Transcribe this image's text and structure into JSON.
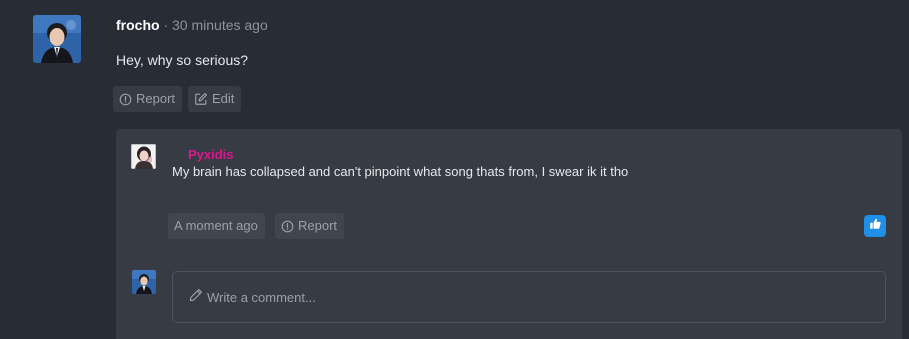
{
  "post": {
    "author": "frocho",
    "separator": "·",
    "time": "30 minutes ago",
    "body": "Hey, why so serious?",
    "report_label": "Report",
    "edit_label": "Edit"
  },
  "reply": {
    "author": "Pyxidis",
    "body": "My brain has collapsed and can't pinpoint what song thats from, I swear ik it tho",
    "time_label": "A moment ago",
    "report_label": "Report"
  },
  "comment": {
    "placeholder": "Write a comment..."
  },
  "colors": {
    "background": "#282c34",
    "panel": "#363b44",
    "reply_author": "#e0158c",
    "like_button": "#1f8fe8",
    "muted_text": "#9aa1ab"
  },
  "icons": {
    "report": "alert-circle-icon",
    "edit": "edit-icon",
    "like": "thumbs-up-icon",
    "comment": "pencil-icon"
  }
}
